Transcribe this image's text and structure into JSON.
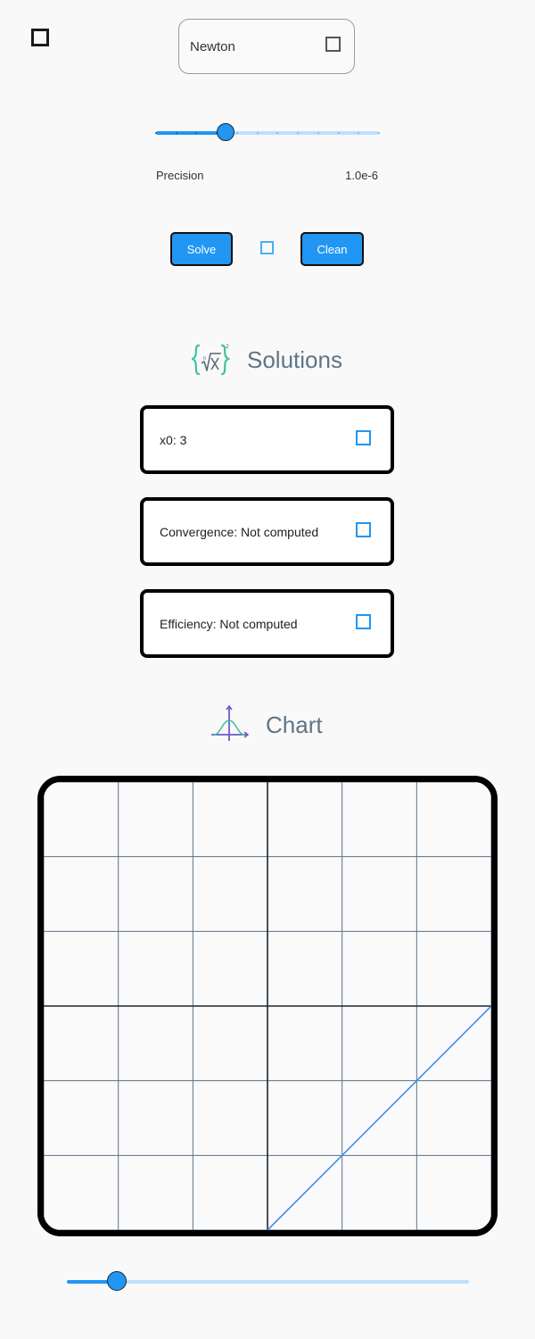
{
  "header": {
    "menu_icon": "square-icon",
    "method": {
      "value": "Newton",
      "icon": "square-icon"
    }
  },
  "precision": {
    "label": "Precision",
    "value_text": "1.0e-6",
    "slider_fraction": 0.31,
    "tick_count": 12
  },
  "actions": {
    "solve_label": "Solve",
    "clean_label": "Clean",
    "middle_icon": "square-icon"
  },
  "solutions": {
    "title": "Solutions",
    "icon": "root-formula-icon",
    "cards": [
      {
        "text": "x0: 3",
        "icon": "square-icon"
      },
      {
        "text": "Convergence: Not computed",
        "icon": "square-icon"
      },
      {
        "text": "Efficiency: Not computed",
        "icon": "square-icon"
      }
    ]
  },
  "chart": {
    "title": "Chart",
    "icon": "bell-curve-axes-icon"
  },
  "chart_data": {
    "type": "line",
    "title": "",
    "xlabel": "",
    "ylabel": "",
    "xlim": [
      -3,
      3
    ],
    "ylim": [
      -3,
      3
    ],
    "grid": true,
    "series": [
      {
        "x": [
          0,
          3
        ],
        "y": [
          -3,
          0
        ]
      }
    ]
  },
  "bottom_slider": {
    "fraction": 0.125
  },
  "colors": {
    "accent": "#2196f3",
    "track": "#bfe0fb",
    "title": "#5f7586",
    "line": "#3d8ef0",
    "grid": "#5b7186"
  }
}
